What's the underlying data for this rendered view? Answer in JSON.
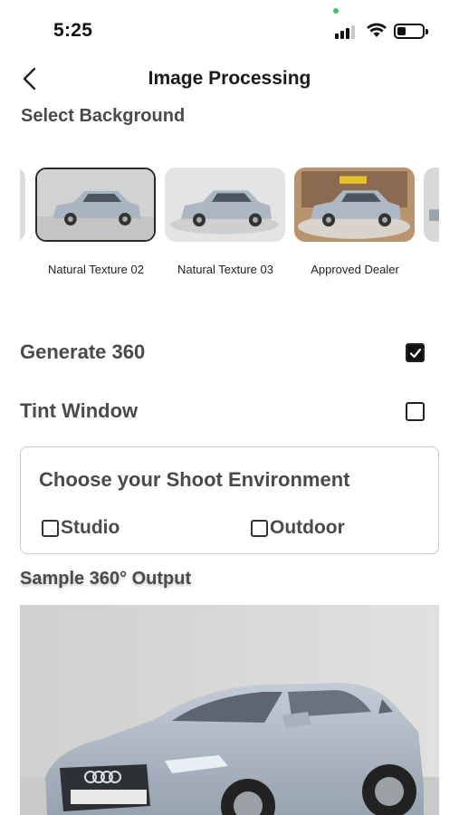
{
  "status_bar": {
    "time": "5:25"
  },
  "header": {
    "title": "Image Processing",
    "back_icon": "chevron-left-icon"
  },
  "background": {
    "section_label": "Select Background",
    "items": [
      {
        "label": "Natural Texture 02",
        "selected": true
      },
      {
        "label": "Natural Texture 03",
        "selected": false
      },
      {
        "label": "Approved Dealer",
        "selected": false
      }
    ]
  },
  "options": {
    "generate_360": {
      "label": "Generate 360",
      "checked": true
    },
    "tint_window": {
      "label": "Tint Window",
      "checked": false
    }
  },
  "environment": {
    "title": "Choose your Shoot Environment",
    "studio": "Studio",
    "outdoor": "Outdoor"
  },
  "sample": {
    "label": "Sample 360° Output"
  },
  "colors": {
    "text_primary": "#4a4a4a",
    "status_dot": "#3cc36b",
    "card_border": "#c9c9c9"
  }
}
